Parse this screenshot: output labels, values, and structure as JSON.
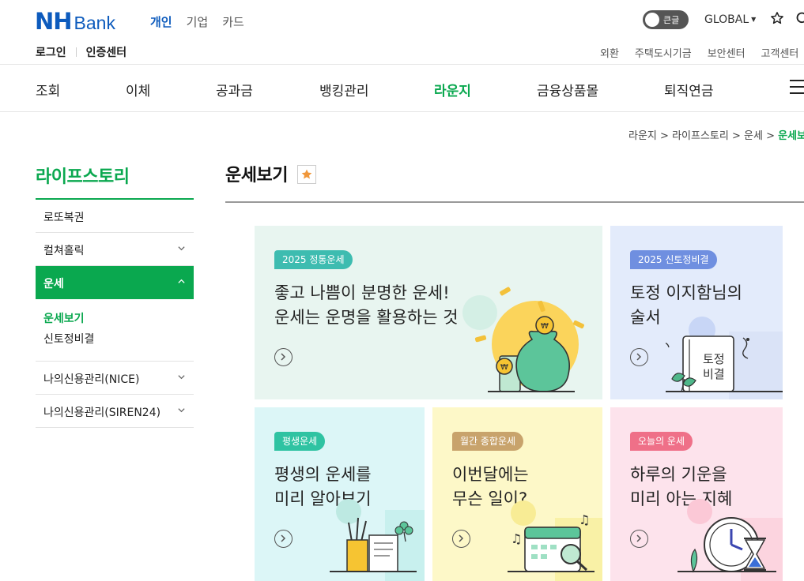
{
  "brand": {
    "logo_mark": "NH",
    "logo_text": "Bank"
  },
  "segments": [
    "개인",
    "기업",
    "카드"
  ],
  "active_segment": "개인",
  "top_right": {
    "toggle_label": "큰글",
    "global_label": "GLOBAL",
    "star_icon": "star-icon",
    "search_icon": "search-icon"
  },
  "login_links": [
    "로그인",
    "인증센터"
  ],
  "util_links": [
    "외환",
    "주택도시기금",
    "보안센터",
    "고객센터"
  ],
  "gnb": [
    "조회",
    "이체",
    "공과금",
    "뱅킹관리",
    "라운지",
    "금융상품몰",
    "퇴직연금"
  ],
  "gnb_active": "라운지",
  "breadcrumb": {
    "items": [
      "라운지",
      "라이프스토리",
      "운세"
    ],
    "current": "운세보기",
    "separator": ">"
  },
  "sidebar": {
    "title": "라이프스토리",
    "items": [
      {
        "label": "로또복권"
      },
      {
        "label": "컬쳐홀릭"
      },
      {
        "label": "운세"
      },
      {
        "label": "나의신용관리(NICE)"
      },
      {
        "label": "나의신용관리(SIREN24)"
      }
    ],
    "subitems": [
      "운세보기",
      "신토정비결"
    ]
  },
  "page": {
    "title": "운세보기"
  },
  "cards": [
    {
      "badge": "2025 정통운세",
      "line1": "좋고 나쁨이 분명한 운세!",
      "line2": "운세는 운명을 활용하는 것",
      "bg": "#e8f5f0",
      "badge_color": "#3dbcb0"
    },
    {
      "badge": "2025 신토정비결",
      "line1": "토정 이지함님의",
      "line2": "술서",
      "bg": "#e3ebfb",
      "badge_color": "#6f8fe0",
      "book_line1": "토정",
      "book_line2": "비결"
    },
    {
      "badge": "평생운세",
      "line1": "평생의 운세를",
      "line2": "미리 알아보기",
      "bg": "#dcf6f7",
      "badge_color": "#2fc3a2"
    },
    {
      "badge": "월간 종합운세",
      "line1": "이번달에는",
      "line2": "무슨 일이?",
      "bg": "#fdf8c8",
      "badge_color": "#c8a36c"
    },
    {
      "badge": "오늘의 운세",
      "line1": "하루의 기운을",
      "line2": "미리 아는 지혜",
      "bg": "#fde3ec",
      "badge_color": "#ef7088"
    }
  ]
}
